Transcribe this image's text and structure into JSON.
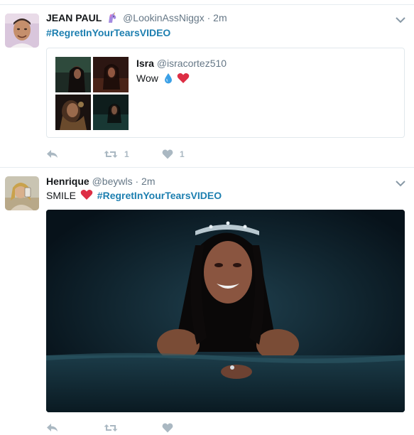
{
  "tweets": [
    {
      "fullname": "JEAN PAUL",
      "handle": "@LookinAssNiggx",
      "separator": "·",
      "time": "2m",
      "hashtag": "#RegretInYourTearsVIDEO",
      "quote": {
        "fullname": "Isra",
        "handle": "@isracortez510",
        "text": "Wow",
        "emojis": [
          "droplet-icon",
          "red-heart-icon"
        ]
      },
      "actions": {
        "reply_icon": "reply-icon",
        "retweet_icon": "retweet-icon",
        "retweet_count": "1",
        "like_icon": "heart-icon",
        "like_count": "1"
      }
    },
    {
      "fullname": "Henrique",
      "handle": "@beywls",
      "separator": "·",
      "time": "2m",
      "text_before": "SMILE",
      "hashtag": "#RegretInYourTearsVIDEO",
      "actions": {
        "reply_icon": "reply-icon",
        "retweet_icon": "retweet-icon",
        "like_icon": "heart-icon"
      }
    }
  ],
  "colors": {
    "hashtag": "#1d7fb0",
    "muted": "#657786",
    "action": "#aab8c2",
    "heart": "#e0245e",
    "divider": "#e6ecf0"
  }
}
